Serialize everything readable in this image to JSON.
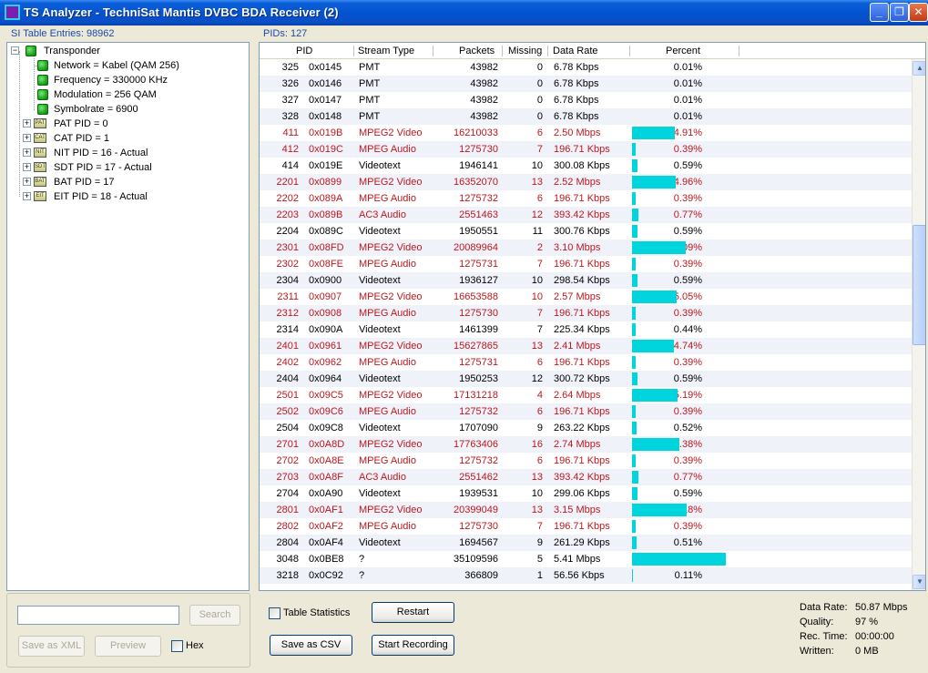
{
  "window": {
    "title": "TS Analyzer - TechniSat Mantis DVBC BDA Receiver (2)",
    "min_glyph": "_",
    "max_glyph": "❐",
    "close_glyph": "✕"
  },
  "left_panel": {
    "label": "SI Table Entries: 98962",
    "tree": {
      "root": "Transponder",
      "root_children": [
        "Network = Kabel (QAM 256)",
        "Frequency = 330000 KHz",
        "Modulation = 256 QAM",
        "Symbolrate = 6900"
      ],
      "tables": [
        {
          "label": "PAT PID = 0",
          "icon": "PAT"
        },
        {
          "label": "CAT PID = 1",
          "icon": "CAT"
        },
        {
          "label": "NIT PID = 16 - Actual",
          "icon": "NIT"
        },
        {
          "label": "SDT PID = 17 - Actual",
          "icon": "SDT"
        },
        {
          "label": "BAT PID = 17",
          "icon": "BAT"
        },
        {
          "label": "EIT PID = 18 - Actual",
          "icon": "EIT"
        }
      ]
    },
    "search_placeholder": "",
    "search_button": "Search",
    "save_xml_button": "Save as XML",
    "preview_button": "Preview",
    "hex_label": "Hex"
  },
  "right_panel": {
    "label": "PIDs: 127",
    "columns": [
      "PID",
      "Stream Type",
      "Packets",
      "Missing",
      "Data Rate",
      "Percent"
    ],
    "rows": [
      {
        "pid": "325",
        "hex": "0x0145",
        "type": "PMT",
        "packets": "43982",
        "missing": "0",
        "rate": "6.78 Kbps",
        "percent": "0.01%",
        "bar": 0.01,
        "red": false
      },
      {
        "pid": "326",
        "hex": "0x0146",
        "type": "PMT",
        "packets": "43982",
        "missing": "0",
        "rate": "6.78 Kbps",
        "percent": "0.01%",
        "bar": 0.01,
        "red": false
      },
      {
        "pid": "327",
        "hex": "0x0147",
        "type": "PMT",
        "packets": "43982",
        "missing": "0",
        "rate": "6.78 Kbps",
        "percent": "0.01%",
        "bar": 0.01,
        "red": false
      },
      {
        "pid": "328",
        "hex": "0x0148",
        "type": "PMT",
        "packets": "43982",
        "missing": "0",
        "rate": "6.78 Kbps",
        "percent": "0.01%",
        "bar": 0.01,
        "red": false
      },
      {
        "pid": "411",
        "hex": "0x019B",
        "type": "MPEG2 Video",
        "packets": "16210033",
        "missing": "6",
        "rate": "2.50 Mbps",
        "percent": "4.91%",
        "bar": 4.91,
        "red": true
      },
      {
        "pid": "412",
        "hex": "0x019C",
        "type": "MPEG Audio",
        "packets": "1275730",
        "missing": "7",
        "rate": "196.71 Kbps",
        "percent": "0.39%",
        "bar": 0.39,
        "red": true
      },
      {
        "pid": "414",
        "hex": "0x019E",
        "type": "Videotext",
        "packets": "1946141",
        "missing": "10",
        "rate": "300.08 Kbps",
        "percent": "0.59%",
        "bar": 0.59,
        "red": false
      },
      {
        "pid": "2201",
        "hex": "0x0899",
        "type": "MPEG2 Video",
        "packets": "16352070",
        "missing": "13",
        "rate": "2.52 Mbps",
        "percent": "4.96%",
        "bar": 4.96,
        "red": true
      },
      {
        "pid": "2202",
        "hex": "0x089A",
        "type": "MPEG Audio",
        "packets": "1275732",
        "missing": "6",
        "rate": "196.71 Kbps",
        "percent": "0.39%",
        "bar": 0.39,
        "red": true
      },
      {
        "pid": "2203",
        "hex": "0x089B",
        "type": "AC3 Audio",
        "packets": "2551463",
        "missing": "12",
        "rate": "393.42 Kbps",
        "percent": "0.77%",
        "bar": 0.77,
        "red": true
      },
      {
        "pid": "2204",
        "hex": "0x089C",
        "type": "Videotext",
        "packets": "1950551",
        "missing": "11",
        "rate": "300.76 Kbps",
        "percent": "0.59%",
        "bar": 0.59,
        "red": false
      },
      {
        "pid": "2301",
        "hex": "0x08FD",
        "type": "MPEG2 Video",
        "packets": "20089964",
        "missing": "2",
        "rate": "3.10 Mbps",
        "percent": "6.09%",
        "bar": 6.09,
        "red": true
      },
      {
        "pid": "2302",
        "hex": "0x08FE",
        "type": "MPEG Audio",
        "packets": "1275731",
        "missing": "7",
        "rate": "196.71 Kbps",
        "percent": "0.39%",
        "bar": 0.39,
        "red": true
      },
      {
        "pid": "2304",
        "hex": "0x0900",
        "type": "Videotext",
        "packets": "1936127",
        "missing": "10",
        "rate": "298.54 Kbps",
        "percent": "0.59%",
        "bar": 0.59,
        "red": false
      },
      {
        "pid": "2311",
        "hex": "0x0907",
        "type": "MPEG2 Video",
        "packets": "16653588",
        "missing": "10",
        "rate": "2.57 Mbps",
        "percent": "5.05%",
        "bar": 5.05,
        "red": true
      },
      {
        "pid": "2312",
        "hex": "0x0908",
        "type": "MPEG Audio",
        "packets": "1275730",
        "missing": "7",
        "rate": "196.71 Kbps",
        "percent": "0.39%",
        "bar": 0.39,
        "red": true
      },
      {
        "pid": "2314",
        "hex": "0x090A",
        "type": "Videotext",
        "packets": "1461399",
        "missing": "7",
        "rate": "225.34 Kbps",
        "percent": "0.44%",
        "bar": 0.44,
        "red": false
      },
      {
        "pid": "2401",
        "hex": "0x0961",
        "type": "MPEG2 Video",
        "packets": "15627865",
        "missing": "13",
        "rate": "2.41 Mbps",
        "percent": "4.74%",
        "bar": 4.74,
        "red": true
      },
      {
        "pid": "2402",
        "hex": "0x0962",
        "type": "MPEG Audio",
        "packets": "1275731",
        "missing": "6",
        "rate": "196.71 Kbps",
        "percent": "0.39%",
        "bar": 0.39,
        "red": true
      },
      {
        "pid": "2404",
        "hex": "0x0964",
        "type": "Videotext",
        "packets": "1950253",
        "missing": "12",
        "rate": "300.72 Kbps",
        "percent": "0.59%",
        "bar": 0.59,
        "red": false
      },
      {
        "pid": "2501",
        "hex": "0x09C5",
        "type": "MPEG2 Video",
        "packets": "17131218",
        "missing": "4",
        "rate": "2.64 Mbps",
        "percent": "5.19%",
        "bar": 5.19,
        "red": true
      },
      {
        "pid": "2502",
        "hex": "0x09C6",
        "type": "MPEG Audio",
        "packets": "1275732",
        "missing": "6",
        "rate": "196.71 Kbps",
        "percent": "0.39%",
        "bar": 0.39,
        "red": true
      },
      {
        "pid": "2504",
        "hex": "0x09C8",
        "type": "Videotext",
        "packets": "1707090",
        "missing": "9",
        "rate": "263.22 Kbps",
        "percent": "0.52%",
        "bar": 0.52,
        "red": false
      },
      {
        "pid": "2701",
        "hex": "0x0A8D",
        "type": "MPEG2 Video",
        "packets": "17763406",
        "missing": "16",
        "rate": "2.74 Mbps",
        "percent": "5.38%",
        "bar": 5.38,
        "red": true
      },
      {
        "pid": "2702",
        "hex": "0x0A8E",
        "type": "MPEG Audio",
        "packets": "1275732",
        "missing": "6",
        "rate": "196.71 Kbps",
        "percent": "0.39%",
        "bar": 0.39,
        "red": true
      },
      {
        "pid": "2703",
        "hex": "0x0A8F",
        "type": "AC3 Audio",
        "packets": "2551462",
        "missing": "13",
        "rate": "393.42 Kbps",
        "percent": "0.77%",
        "bar": 0.77,
        "red": true
      },
      {
        "pid": "2704",
        "hex": "0x0A90",
        "type": "Videotext",
        "packets": "1939531",
        "missing": "10",
        "rate": "299.06 Kbps",
        "percent": "0.59%",
        "bar": 0.59,
        "red": false
      },
      {
        "pid": "2801",
        "hex": "0x0AF1",
        "type": "MPEG2 Video",
        "packets": "20399049",
        "missing": "13",
        "rate": "3.15 Mbps",
        "percent": "6.18%",
        "bar": 6.18,
        "red": true
      },
      {
        "pid": "2802",
        "hex": "0x0AF2",
        "type": "MPEG Audio",
        "packets": "1275730",
        "missing": "7",
        "rate": "196.71 Kbps",
        "percent": "0.39%",
        "bar": 0.39,
        "red": true
      },
      {
        "pid": "2804",
        "hex": "0x0AF4",
        "type": "Videotext",
        "packets": "1694567",
        "missing": "9",
        "rate": "261.29 Kbps",
        "percent": "0.51%",
        "bar": 0.51,
        "red": false
      },
      {
        "pid": "3048",
        "hex": "0x0BE8",
        "type": "?",
        "packets": "35109596",
        "missing": "5",
        "rate": "5.41 Mbps",
        "percent": "10.64%",
        "bar": 10.64,
        "red": false
      },
      {
        "pid": "3218",
        "hex": "0x0C92",
        "type": "?",
        "packets": "366809",
        "missing": "1",
        "rate": "56.56 Kbps",
        "percent": "0.11%",
        "bar": 0.11,
        "red": false
      }
    ],
    "bar_scale_percent": 12,
    "table_statistics_label": "Table Statistics",
    "restart_button": "Restart",
    "save_csv_button": "Save as CSV",
    "start_recording_button": "Start Recording"
  },
  "status": {
    "data_rate_label": "Data Rate:",
    "data_rate_value": "50.87 Mbps",
    "quality_label": "Quality:",
    "quality_value": "97 %",
    "rec_time_label": "Rec. Time:",
    "rec_time_value": "00:00:00",
    "written_label": "Written:",
    "written_value": "0 MB"
  }
}
